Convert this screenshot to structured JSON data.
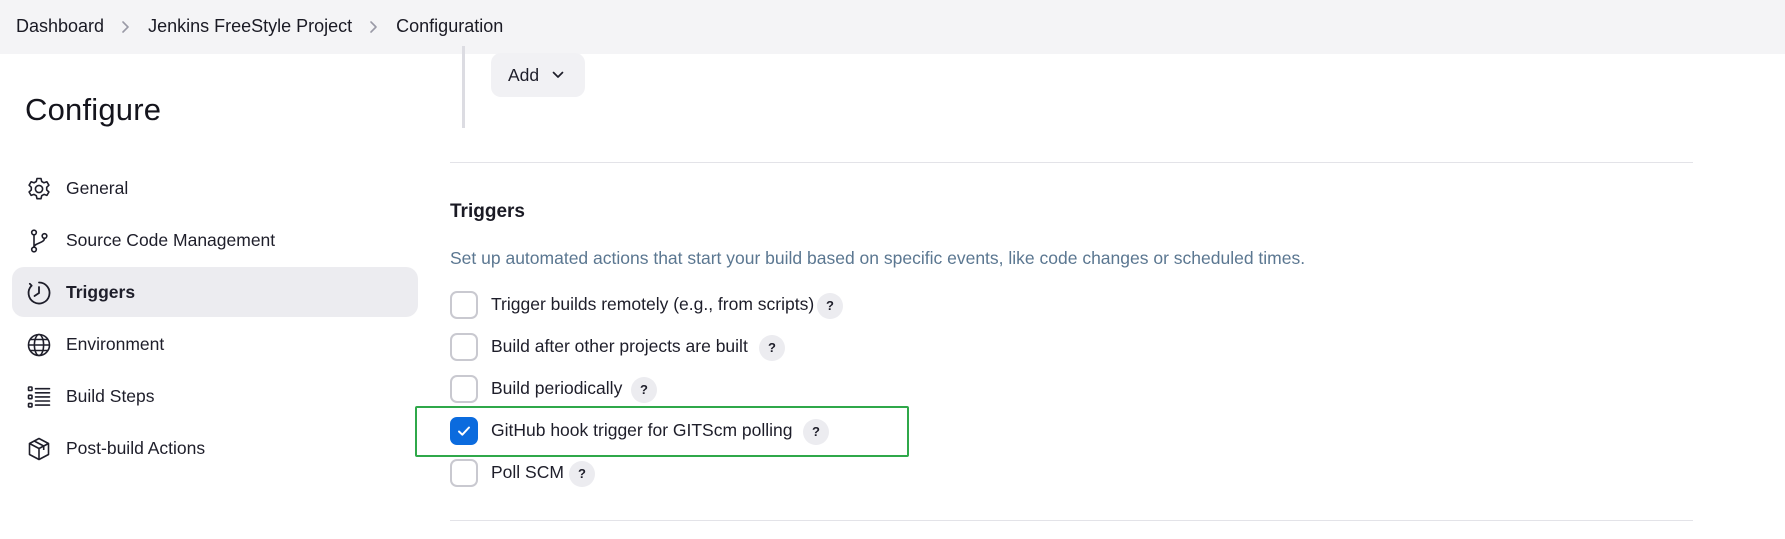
{
  "breadcrumb": {
    "items": [
      "Dashboard",
      "Jenkins FreeStyle Project",
      "Configuration"
    ]
  },
  "sidebar": {
    "title": "Configure",
    "items": [
      {
        "label": "General",
        "icon": "gear-icon"
      },
      {
        "label": "Source Code Management",
        "icon": "branch-icon"
      },
      {
        "label": "Triggers",
        "icon": "clock-icon",
        "active": true
      },
      {
        "label": "Environment",
        "icon": "globe-icon"
      },
      {
        "label": "Build Steps",
        "icon": "list-icon"
      },
      {
        "label": "Post-build Actions",
        "icon": "package-icon"
      }
    ]
  },
  "main": {
    "add_button_label": "Add",
    "triggers": {
      "title": "Triggers",
      "description": "Set up automated actions that start your build based on specific events, like code changes or scheduled times.",
      "help_label": "?",
      "options": [
        {
          "label": "Trigger builds remotely (e.g., from scripts)",
          "checked": false
        },
        {
          "label": "Build after other projects are built",
          "checked": false
        },
        {
          "label": "Build periodically",
          "checked": false
        },
        {
          "label": "GitHub hook trigger for GITScm polling",
          "checked": true
        },
        {
          "label": "Poll SCM",
          "checked": false
        }
      ]
    }
  },
  "colors": {
    "accent": "#0b6bde",
    "highlight": "#2fa84a",
    "description": "#5b7791"
  }
}
